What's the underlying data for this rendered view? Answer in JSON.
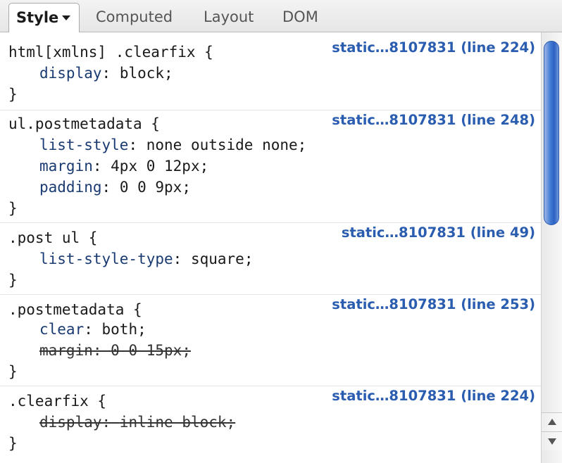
{
  "tabs": {
    "style": "Style",
    "computed": "Computed",
    "layout": "Layout",
    "dom": "DOM"
  },
  "rules": [
    {
      "selector": "html[xmlns] .clearfix {",
      "source": "static…8107831 (line 224)",
      "props": [
        {
          "name": "display",
          "value": "block",
          "overridden": false
        }
      ],
      "close": "}"
    },
    {
      "selector": "ul.postmetadata {",
      "source": "static…8107831 (line 248)",
      "props": [
        {
          "name": "list-style",
          "value": "none outside none",
          "overridden": false
        },
        {
          "name": "margin",
          "value": "4px 0 12px",
          "overridden": false
        },
        {
          "name": "padding",
          "value": "0 0 9px",
          "overridden": false
        }
      ],
      "close": "}"
    },
    {
      "selector": ".post ul {",
      "source": "static…8107831 (line 49)",
      "props": [
        {
          "name": "list-style-type",
          "value": "square",
          "overridden": false
        }
      ],
      "close": "}"
    },
    {
      "selector": ".postmetadata {",
      "source": "static…8107831 (line 253)",
      "props": [
        {
          "name": "clear",
          "value": "both",
          "overridden": false
        },
        {
          "name": "margin",
          "value": "0 0 15px",
          "overridden": true
        }
      ],
      "close": "}"
    },
    {
      "selector": ".clearfix {",
      "source": "static…8107831 (line 224)",
      "props": [
        {
          "name": "display",
          "value": "inline-block",
          "overridden": true
        }
      ],
      "close": "}"
    }
  ],
  "colors": {
    "source_link": "#2a5db0",
    "property_name": "#1a3a72",
    "scroll_thumb": "#2d62c4"
  },
  "icons": {
    "style_menu": "chevron-down-icon",
    "scroll_up": "arrow-up-icon",
    "scroll_down": "arrow-down-icon"
  }
}
